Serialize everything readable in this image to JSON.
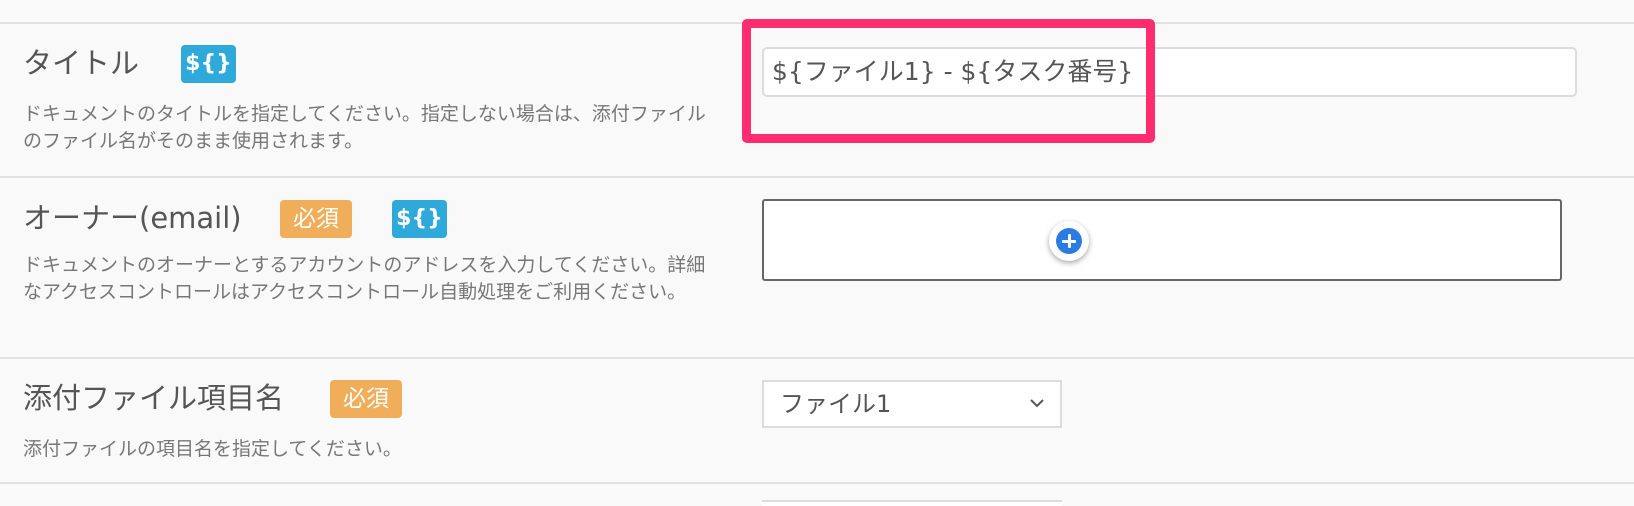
{
  "fields": {
    "title": {
      "label": "タイトル",
      "var_badge": "${}",
      "description": "ドキュメントのタイトルを指定してください。指定しない場合は、添付ファイルのファイル名がそのまま使用されます。",
      "value": "${ファイル1} - ${タスク番号}"
    },
    "owner": {
      "label": "オーナー(email)",
      "required_badge": "必須",
      "var_badge": "${}",
      "description": "ドキュメントのオーナーとするアカウントのアドレスを入力してください。詳細なアクセスコントロールはアクセスコントロール自動処理をご利用ください。"
    },
    "attachment": {
      "label": "添付ファイル項目名",
      "required_badge": "必須",
      "description": "添付ファイルの項目名を指定してください。",
      "selected": "ファイル1"
    }
  },
  "icons": {
    "add": "plus-circle-icon",
    "dropdown": "chevron-down-icon"
  },
  "colors": {
    "var_badge": "#2fa9d9",
    "required_badge": "#f0ad5a",
    "highlight": "#ff2d70",
    "add_button": "#2b7be3"
  }
}
